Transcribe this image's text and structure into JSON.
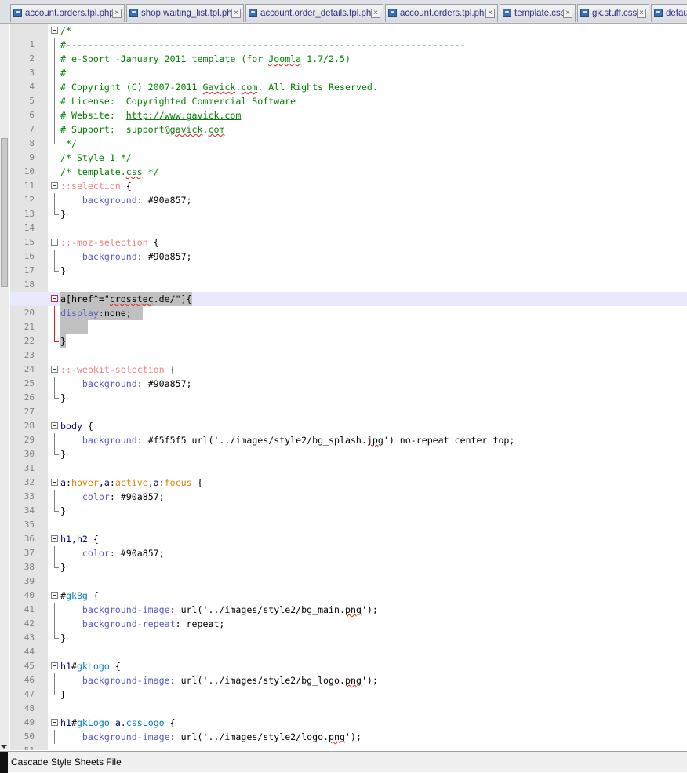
{
  "tabs": [
    {
      "label": "account.orders.tpl.php",
      "close": "×"
    },
    {
      "label": "shop.waiting_list.tpl.php",
      "close": "×"
    },
    {
      "label": "account.order_details.tpl.php",
      "close": "×"
    },
    {
      "label": "account.orders.tpl.php",
      "close": "×"
    },
    {
      "label": "template.css",
      "close": "×"
    },
    {
      "label": "gk.stuff.css",
      "close": "×"
    },
    {
      "label": "defau",
      "close": ""
    }
  ],
  "editor": {
    "line_numbers": [
      "1",
      "2",
      "3",
      "4",
      "5",
      "6",
      "7",
      "8",
      "9",
      "10",
      "11",
      "12",
      "13",
      "14",
      "15",
      "16",
      "17",
      "18",
      "19",
      "20",
      "21",
      "22",
      "23",
      "24",
      "25",
      "26",
      "27",
      "28",
      "29",
      "30",
      "31",
      "32",
      "33",
      "34",
      "35",
      "36",
      "37",
      "38",
      "39",
      "40",
      "41",
      "42",
      "43",
      "44",
      "45",
      "46",
      "47",
      "48",
      "49",
      "50",
      "51"
    ],
    "code": {
      "l1": "/*",
      "l2": "#-------------------------------------------------------------------------",
      "l3a": "# e-Sport -January 2011 template (for ",
      "l3b": "Joomla",
      "l3c": " 1.7/2.5)",
      "l4": "#",
      "l5a": "# Copyright (C) 2007-2011 ",
      "l5b": "Gavick",
      "l5c": ".",
      "l5d": "com",
      "l5e": ". All Rights Reserved.",
      "l6": "# License:  Copyrighted Commercial Software",
      "l7a": "# Website:  ",
      "l7b": "http://www.gavick.com",
      "l8a": "# Support:  support@",
      "l8b": "gavick",
      "l8c": ".",
      "l8d": "com",
      "l9": " */",
      "l10": "/* Style 1 */",
      "l11a": "/* template.",
      "l11b": "css",
      "l11c": " */",
      "l12a": "::selection",
      "l12b": " {",
      "l13a": "    background",
      "l13b": ": #90a857;",
      "l14": "}",
      "l16a": "::-moz-selection",
      "l16b": " {",
      "l17a": "    background",
      "l17b": ": #90a857;",
      "l18": "}",
      "l20a": "a[href^=\"",
      "l20b": "crosstec",
      "l20c": ".de/\"]{",
      "l21a": "display",
      "l21b": ":none;",
      "l23": "}",
      "l25a": "::-webkit-selection",
      "l25b": " {",
      "l26a": "    background",
      "l26b": ": #90a857;",
      "l27": "}",
      "l29a": "body",
      "l29b": " {",
      "l30a": "    background",
      "l30b": ": #f5f5f5 url('../images/style2/bg_splash.",
      "l30c": "jpg",
      "l30d": "') no-repeat center top;",
      "l31": "}",
      "l33a": "a",
      "l33b": ":",
      "l33c": "hover",
      "l33d": ",a",
      "l33e": ":",
      "l33f": "active",
      "l33g": ",a",
      "l33h": ":",
      "l33i": "focus",
      "l33j": " {",
      "l34a": "    color",
      "l34b": ": #90a857;",
      "l35": "}",
      "l37a": "h1,h2",
      "l37b": " {",
      "l38a": "    color",
      "l38b": ": #90a857;",
      "l39": "}",
      "l41a": "#",
      "l41b": "gkBg",
      "l41c": " {",
      "l42a": "    background-image",
      "l42b": ": url('../images/style2/bg_main.",
      "l42c": "png",
      "l42d": "');",
      "l43a": "    background-repeat",
      "l43b": ": repeat;",
      "l44": "}",
      "l46a": "h1",
      "l46b": "#",
      "l46c": "gkLogo",
      "l46d": " {",
      "l47a": "    background-image",
      "l47b": ": url('../images/style2/bg_logo.",
      "l47c": "png",
      "l47d": "');",
      "l48": "}",
      "l50a": "h1",
      "l50b": "#",
      "l50c": "gkLogo",
      "l50d": " a.",
      "l50e": "cssLogo",
      "l50f": " {",
      "l51a": "    background-image",
      "l51b": ": url('../images/style2/logo.",
      "l51c": "png",
      "l51d": "');"
    }
  },
  "statusbar": {
    "file_type": "Cascade Style Sheets File"
  }
}
